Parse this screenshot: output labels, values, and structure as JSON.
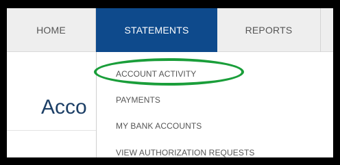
{
  "nav": {
    "items": [
      {
        "label": "HOME"
      },
      {
        "label": "STATEMENTS",
        "active": true
      },
      {
        "label": "REPORTS"
      }
    ]
  },
  "page": {
    "title_partial": "Acco"
  },
  "dropdown": {
    "items": [
      {
        "label": "ACCOUNT ACTIVITY",
        "highlighted": true
      },
      {
        "label": "PAYMENTS"
      },
      {
        "label": "MY BANK ACCOUNTS"
      },
      {
        "label": "VIEW AUTHORIZATION REQUESTS"
      }
    ]
  },
  "colors": {
    "active_tab": "#0e4a8c",
    "annotation_ring": "#1a9e3a",
    "title_text": "#1c3f66"
  }
}
